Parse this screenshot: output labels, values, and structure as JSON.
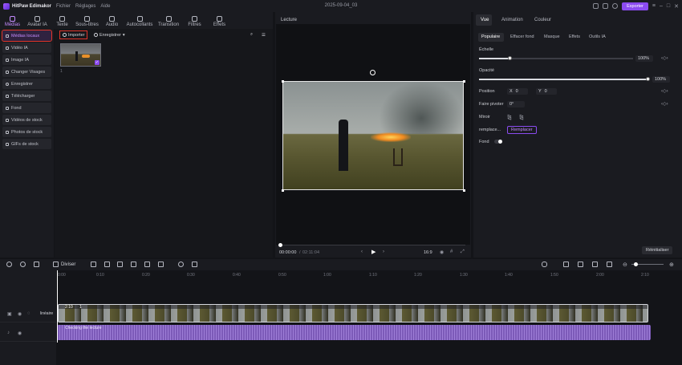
{
  "app": {
    "name": "HitPaw Edimakor",
    "project_name": "2025-09-04_03"
  },
  "menu": [
    "Fichier",
    "Réglages",
    "Aide"
  ],
  "titlebar": {
    "export_label": "Exporter"
  },
  "toolbar": [
    "Médias",
    "Avatar IA",
    "Texte",
    "Sous-titres",
    "Audio",
    "Autocollants",
    "Transition",
    "Filtres",
    "Effets"
  ],
  "sidebar": [
    "Médias locaux",
    "Vidéo IA",
    "Image IA",
    "Changer Visages",
    "Enregistrer",
    "Télécharger",
    "Fond",
    "Vidéos de stock",
    "Photos de stock",
    "GIFs de stock"
  ],
  "media": {
    "import_label": "Importer",
    "record_label": "Enregistrer",
    "thumb_index": "1"
  },
  "preview": {
    "title": "Lecture",
    "time_current": "00:00:00",
    "time_total": "02:11:04",
    "aspect": "16:9",
    "progress": 0
  },
  "inspector": {
    "tabs": [
      "Vue",
      "Animation",
      "Couleur"
    ],
    "subtabs": [
      "Populaire",
      "Effacer fond",
      "Masque",
      "Effets",
      "Outils IA"
    ],
    "scale_label": "Échelle",
    "scale_value": "100%",
    "scale_fraction": 0.2,
    "opacity_label": "Opacité",
    "opacity_value": "100%",
    "opacity_fraction": 1.0,
    "position_label": "Position",
    "pos_x_label": "X",
    "pos_x": "0",
    "pos_y_label": "Y",
    "pos_y": "0",
    "rotate_label": "Faire pivoter",
    "rotate_value": "0°",
    "mirror_label": "Miroir",
    "replace_label": "remplace...",
    "replace_button": "Remplacer",
    "background_label": "Fond",
    "reset_button": "Réinitialiser"
  },
  "timeline": {
    "split_label": "Diviser",
    "ruler": [
      "0:00",
      "0:10",
      "0:20",
      "0:30",
      "0:40",
      "0:50",
      "1:00",
      "1:10",
      "1:20",
      "1:30",
      "1:40",
      "1:50",
      "2:00",
      "2:10"
    ],
    "track_label": "linéaire",
    "video_clip_label": "2:10",
    "video_clip_index": "1",
    "audio_clip_label": "Checking the lecture"
  }
}
